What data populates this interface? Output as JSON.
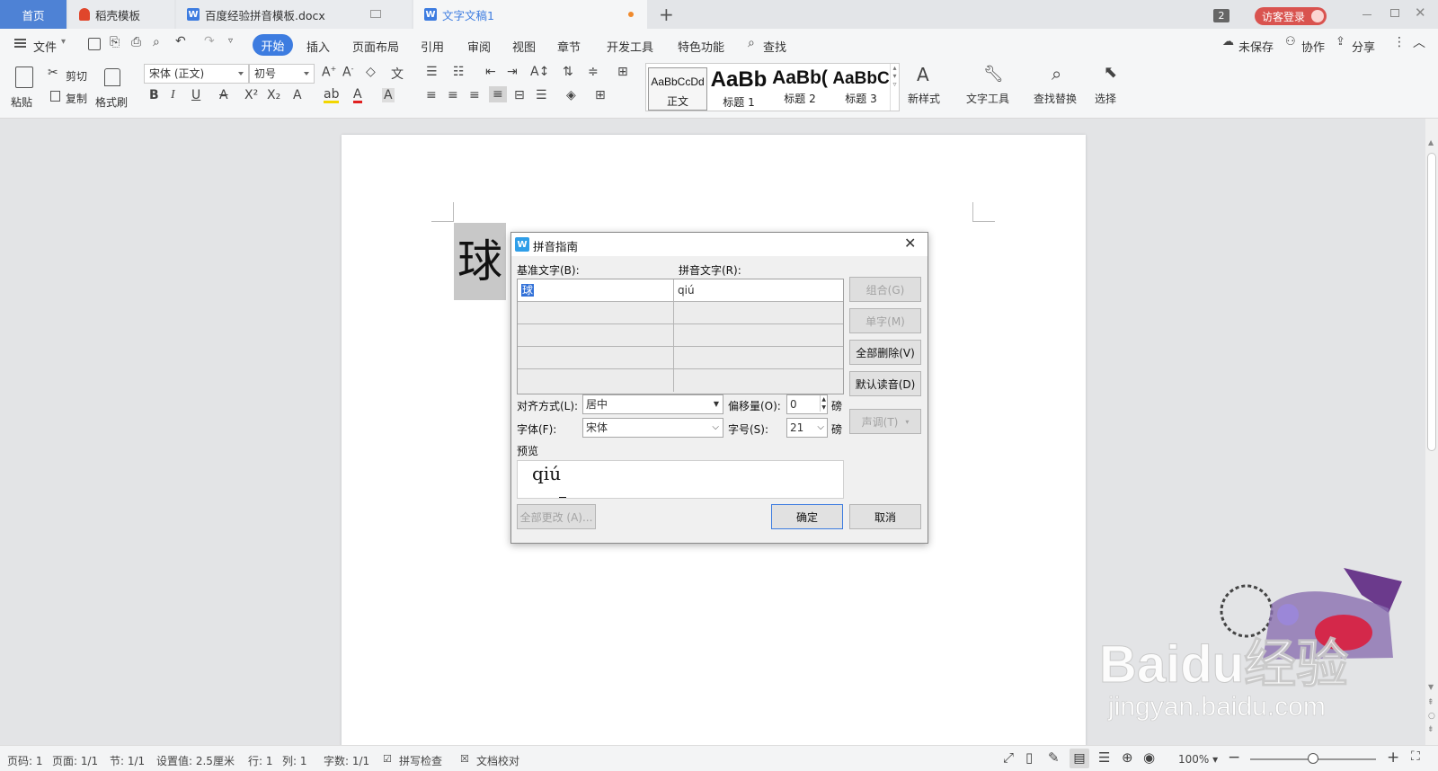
{
  "tabs": {
    "home": "首页",
    "daoke": "稻壳模板",
    "doc1": "百度经验拼音模板.docx",
    "doc2": "文字文稿1",
    "count": "2",
    "login": "访客登录"
  },
  "menu": {
    "file": "文件",
    "start": "开始",
    "items": [
      "插入",
      "页面布局",
      "引用",
      "审阅",
      "视图",
      "章节",
      "开发工具",
      "特色功能"
    ],
    "search": "查找",
    "unsaved": "未保存",
    "collab": "协作",
    "share": "分享"
  },
  "ribbon": {
    "paste": "粘贴",
    "cut": "剪切",
    "copy": "复制",
    "format_painter": "格式刷",
    "font_name": "宋体 (正文)",
    "font_size": "初号",
    "bold": "B",
    "italic": "I",
    "underline": "U",
    "styles": [
      {
        "preview": "AaBbCcDd",
        "name": "正文"
      },
      {
        "preview": "AaBb",
        "name": "标题 1"
      },
      {
        "preview": "AaBb(",
        "name": "标题 2"
      },
      {
        "preview": "AaBbC",
        "name": "标题 3"
      }
    ],
    "new_style": "新样式",
    "text_tools": "文字工具",
    "find_replace": "查找替换",
    "select": "选择"
  },
  "document": {
    "char": "球"
  },
  "dialog": {
    "title": "拼音指南",
    "base_label": "基准文字(B):",
    "ruby_label": "拼音文字(R):",
    "rows": [
      {
        "base": "球",
        "ruby": "qiú"
      },
      {
        "base": "",
        "ruby": ""
      },
      {
        "base": "",
        "ruby": ""
      },
      {
        "base": "",
        "ruby": ""
      },
      {
        "base": "",
        "ruby": ""
      }
    ],
    "btn_group": "组合(G)",
    "btn_mono": "单字(M)",
    "btn_clear": "全部删除(V)",
    "btn_default": "默认读音(D)",
    "btn_tone": "声调(T)",
    "align_label": "对齐方式(L):",
    "align_value": "居中",
    "offset_label": "偏移量(O):",
    "offset_value": "0",
    "offset_unit": "磅",
    "font_label": "字体(F):",
    "font_value": "宋体",
    "size_label": "字号(S):",
    "size_value": "21",
    "size_unit": "磅",
    "preview_label": "预览",
    "preview_ruby": "qiú",
    "btn_apply_all": "全部更改 (A)...",
    "btn_ok": "确定",
    "btn_cancel": "取消"
  },
  "status": {
    "page": "页码: 1",
    "pages": "页面: 1/1",
    "section": "节: 1/1",
    "setting": "设置值: 2.5厘米",
    "line": "行: 1",
    "col": "列: 1",
    "words": "字数: 1/1",
    "spell": "拼写检查",
    "proof": "文档校对",
    "zoom": "100%",
    "zoom_level": 0.5
  },
  "watermark": {
    "logo": "Baidu经验",
    "url": "jingyan.baidu.com"
  },
  "colors": {
    "accent": "#3d7ce0",
    "login": "#d9534f"
  }
}
